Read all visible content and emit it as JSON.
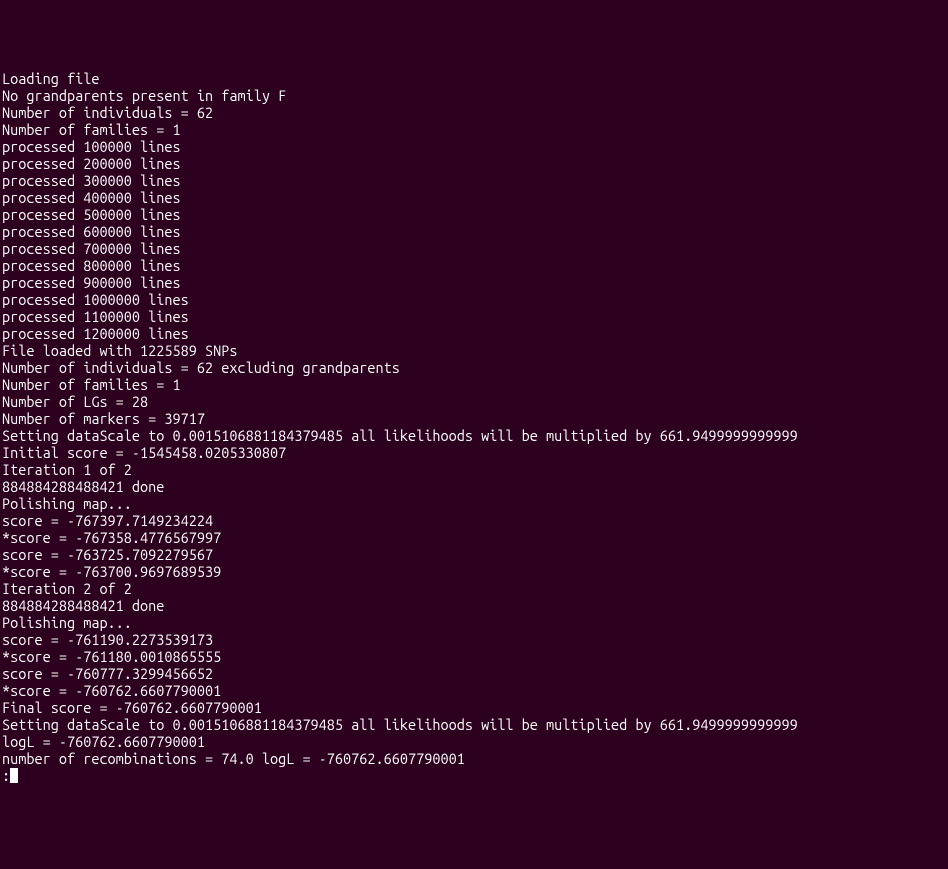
{
  "lines": [
    "Loading file",
    "No grandparents present in family F",
    "Number of individuals = 62",
    "Number of families = 1",
    "processed 100000 lines",
    "processed 200000 lines",
    "processed 300000 lines",
    "processed 400000 lines",
    "processed 500000 lines",
    "processed 600000 lines",
    "processed 700000 lines",
    "processed 800000 lines",
    "processed 900000 lines",
    "processed 1000000 lines",
    "processed 1100000 lines",
    "processed 1200000 lines",
    "File loaded with 1225589 SNPs",
    "Number of individuals = 62 excluding grandparents",
    "Number of families = 1",
    "Number of LGs = 28",
    "Number of markers = 39717",
    "Setting dataScale to 0.0015106881184379485 all likelihoods will be multiplied by 661.9499999999999",
    "Initial score = -1545458.0205330807",
    "Iteration 1 of 2",
    "884884288488421 done",
    "Polishing map...",
    "score = -767397.7149234224",
    "*score = -767358.4776567997",
    "score = -763725.7092279567",
    "*score = -763700.9697689539",
    "Iteration 2 of 2",
    "884884288488421 done",
    "Polishing map...",
    "score = -761190.2273539173",
    "*score = -761180.0010865555",
    "score = -760777.3299456652",
    "*score = -760762.6607790001",
    "Final score = -760762.6607790001",
    "Setting dataScale to 0.0015106881184379485 all likelihoods will be multiplied by 661.9499999999999",
    "logL = -760762.6607790001",
    "number of recombinations = 74.0 logL = -760762.6607790001"
  ],
  "prompt": ":"
}
